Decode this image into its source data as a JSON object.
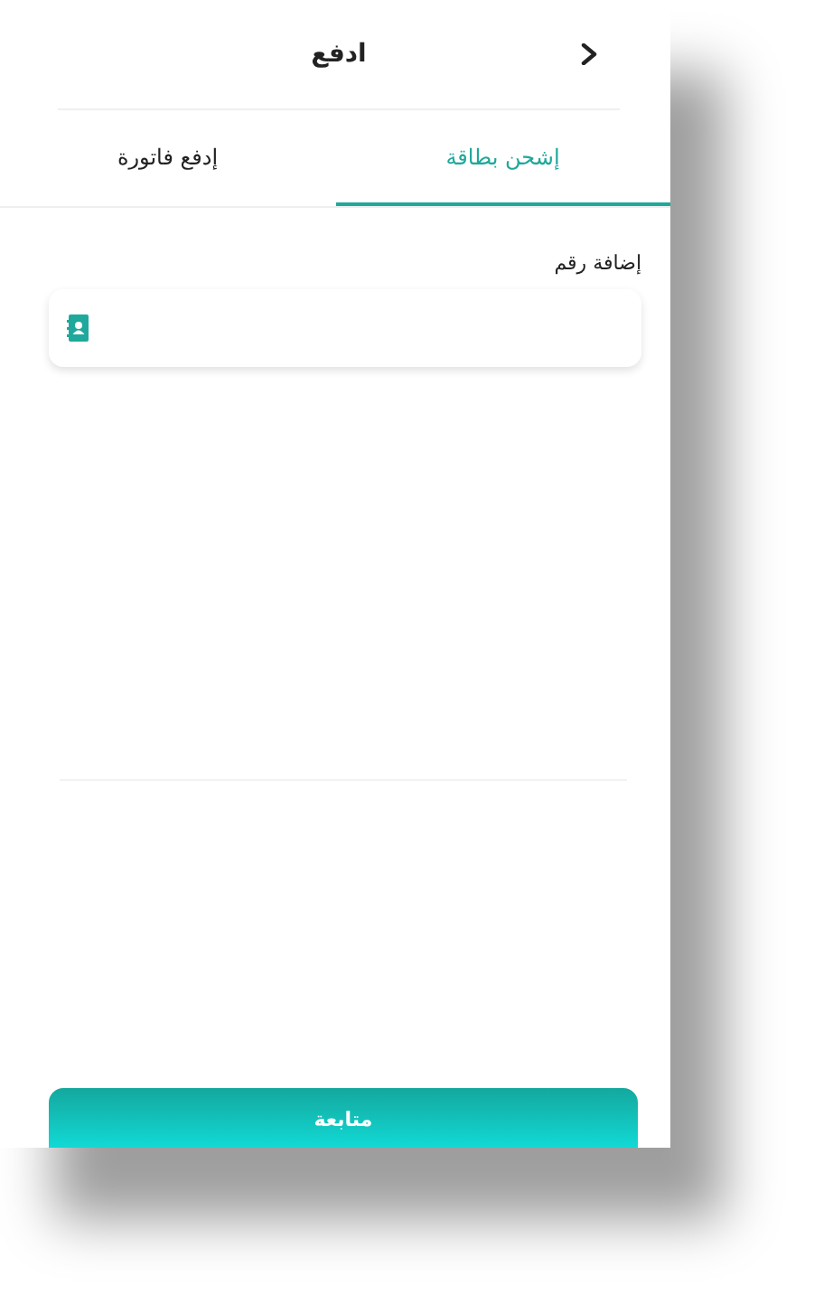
{
  "header": {
    "title": "ادفع"
  },
  "tabs": [
    {
      "label": "إشحن بطاقة",
      "selected": true
    },
    {
      "label": "إدفع فاتورة",
      "selected": false
    }
  ],
  "number_field": {
    "label": "إضافة رقم"
  },
  "continue_button": {
    "label": "متابعة"
  }
}
